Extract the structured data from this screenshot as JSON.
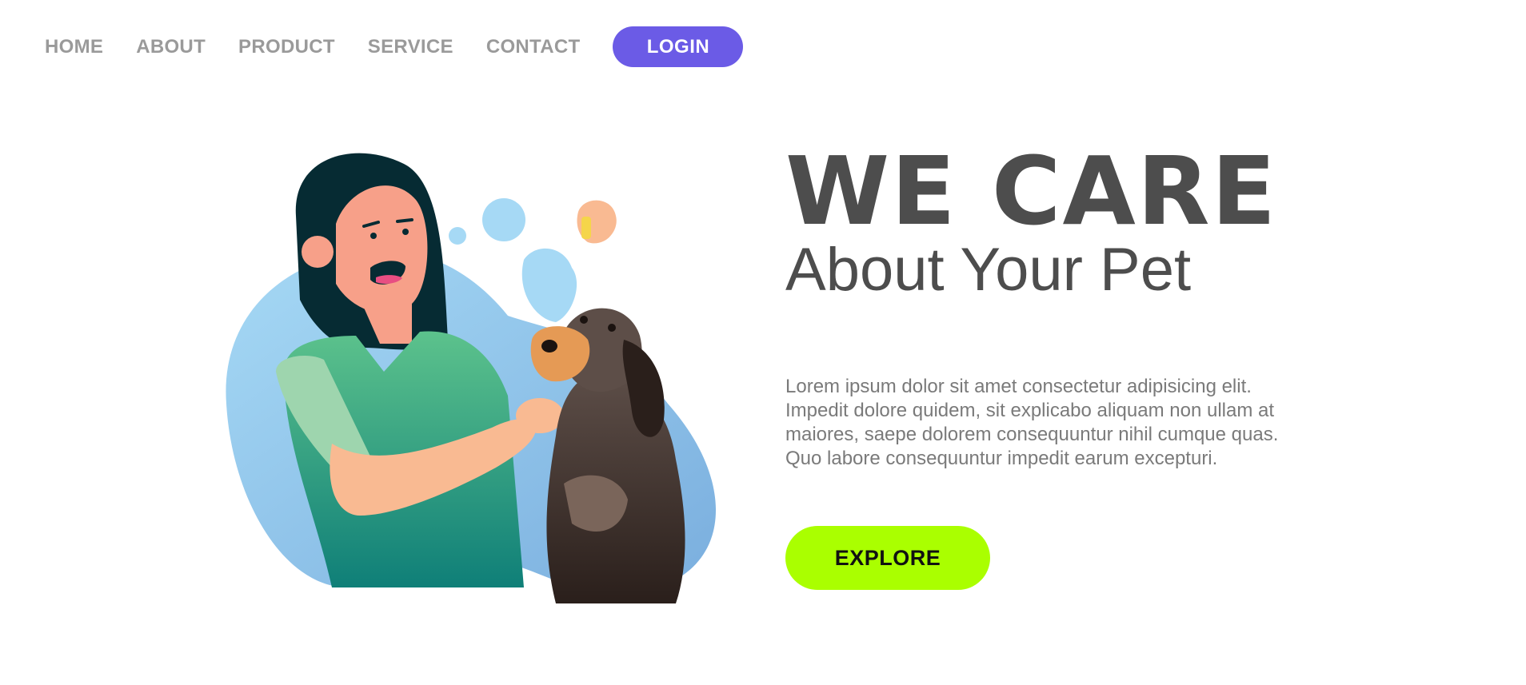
{
  "nav": {
    "items": [
      {
        "label": "HOME"
      },
      {
        "label": "ABOUT"
      },
      {
        "label": "PRODUCT"
      },
      {
        "label": "SERVICE"
      },
      {
        "label": "CONTACT"
      }
    ],
    "login_label": "LOGIN"
  },
  "hero": {
    "headline": "WE CARE",
    "subheadline": "About Your Pet",
    "description": "Lorem ipsum dolor sit amet consectetur adipisicing elit. Impedit dolore quidem, sit explicabo aliquam non ullam at maiores, saepe dolorem consequuntur nihil cumque quas. Quo labore consequuntur impedit earum excepturi.",
    "cta_label": "EXPLORE"
  },
  "colors": {
    "accent_purple": "#6b5be6",
    "accent_lime": "#aaff00",
    "text_dark": "#4d4d4d",
    "text_muted": "#9a9a9a"
  }
}
